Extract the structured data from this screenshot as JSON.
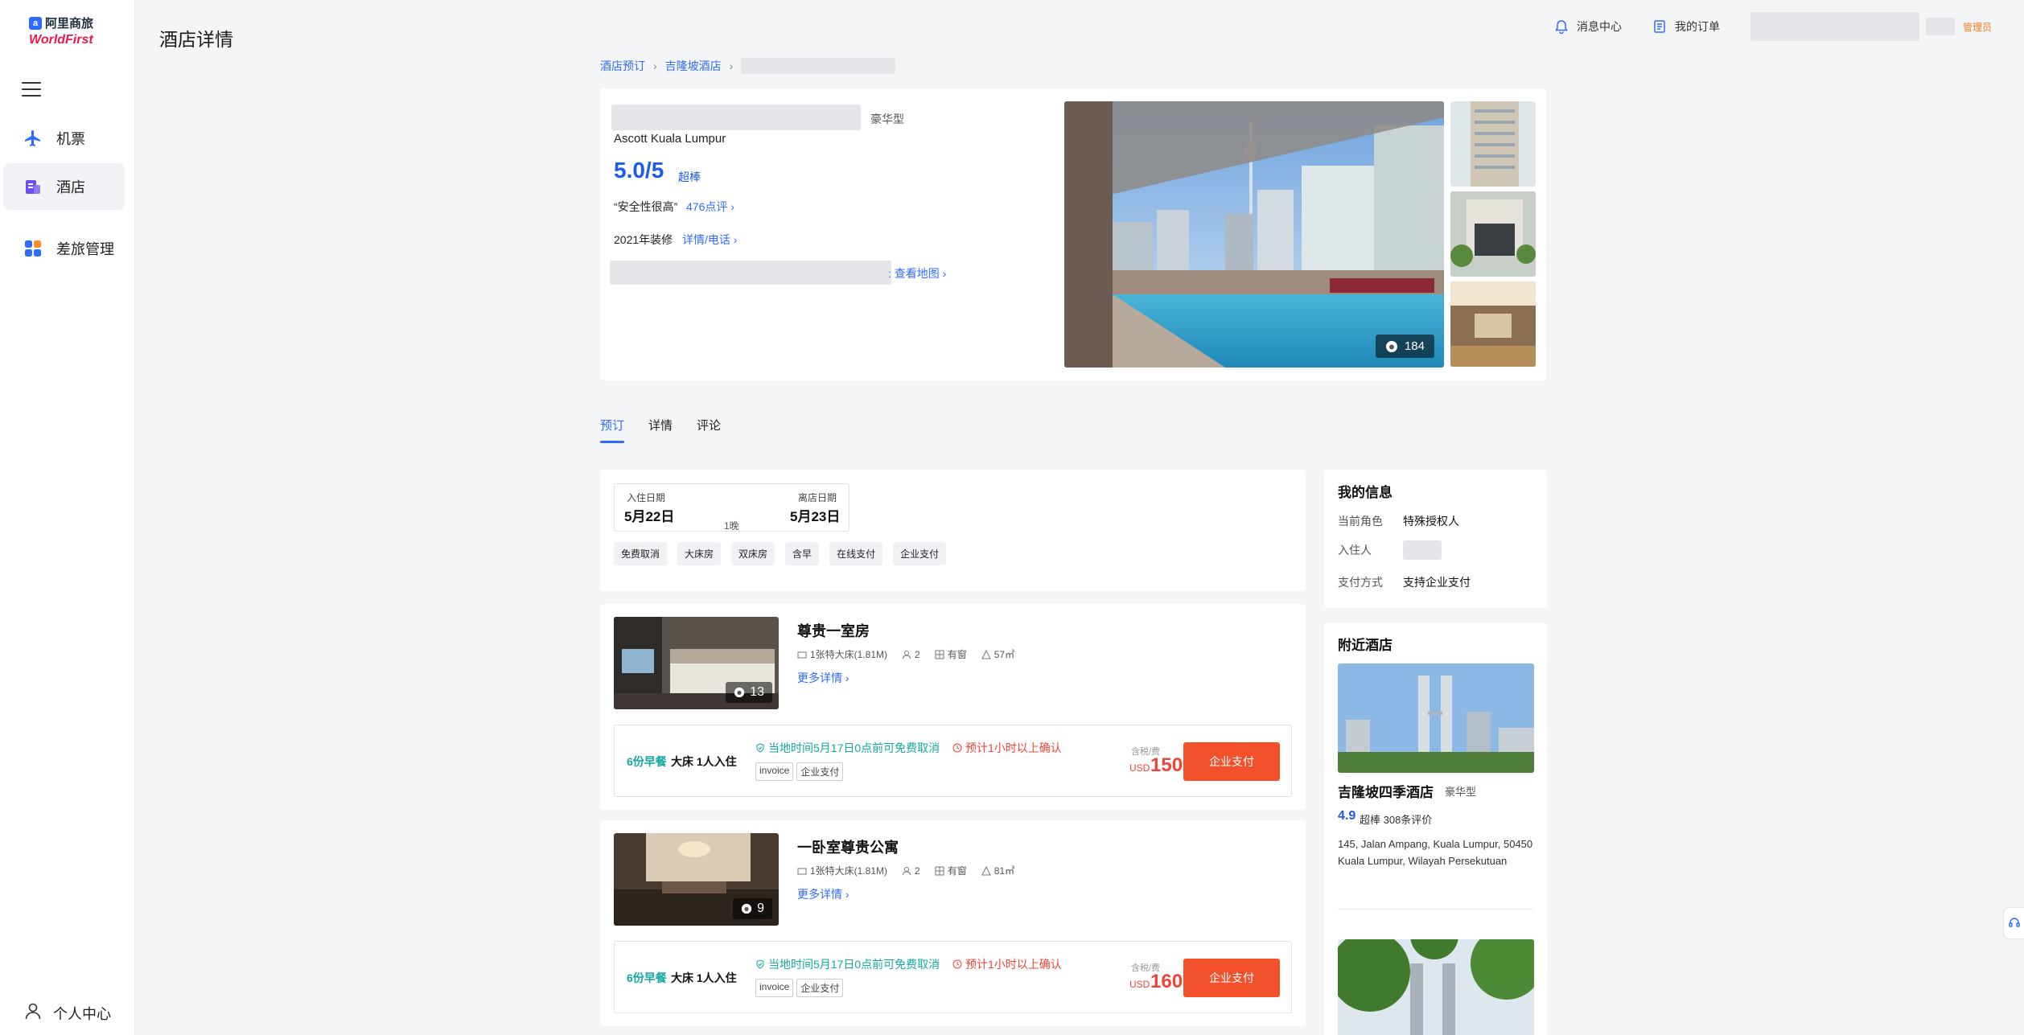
{
  "brand": {
    "line1": "阿里商旅",
    "line2": "WorldFirst"
  },
  "sidebar": {
    "items": [
      {
        "label": "机票",
        "icon": "plane-icon"
      },
      {
        "label": "酒店",
        "icon": "hotel-icon"
      },
      {
        "label": "差旅管理",
        "icon": "grid-icon"
      }
    ],
    "user_center": "个人中心"
  },
  "header": {
    "title": "酒店详情",
    "messages": "消息中心",
    "orders": "我的订单",
    "admin": "管理员"
  },
  "breadcrumb": {
    "home": "酒店预订",
    "city": "吉隆坡酒店"
  },
  "hotel": {
    "type": "豪华型",
    "name_en": "Ascott Kuala Lumpur",
    "score": "5.0/5",
    "score_word": "超棒",
    "quote": "“安全性很高”",
    "reviews": "476点评 ›",
    "renovation": "2021年装修",
    "detail_link": "详情/电话 ›",
    "map_link": ": 查看地图 ›",
    "photo_count": "184"
  },
  "tabs": [
    "预订",
    "详情",
    "评论"
  ],
  "dates": {
    "checkin_label": "入住日期",
    "checkin": "5月22日",
    "checkout_label": "离店日期",
    "checkout": "5月23日",
    "nights": "1晚"
  },
  "filters": [
    "免费取消",
    "大床房",
    "双床房",
    "含早",
    "在线支付",
    "企业支付"
  ],
  "rooms": [
    {
      "name": "尊贵一室房",
      "bed": "1张特大床(1.81M)",
      "guests": "2",
      "window": "有窗",
      "area": "57㎡",
      "more": "更多详情 ›",
      "photo_count": "13",
      "rate": {
        "meal": "6份早餐",
        "bed_type": "大床 1人入住",
        "cancel": "当地时间5月17日0点前可免费取消",
        "confirm": "预计1小时以上确认",
        "tags": [
          "invoice",
          "企业支付"
        ],
        "tax": "含税/费",
        "currency": "USD",
        "price": "150",
        "button": "企业支付"
      }
    },
    {
      "name": "一卧室尊贵公寓",
      "bed": "1张特大床(1.81M)",
      "guests": "2",
      "window": "有窗",
      "area": "81㎡",
      "more": "更多详情 ›",
      "photo_count": "9",
      "rate": {
        "meal": "6份早餐",
        "bed_type": "大床 1人入住",
        "cancel": "当地时间5月17日0点前可免费取消",
        "confirm": "预计1小时以上确认",
        "tags": [
          "invoice",
          "企业支付"
        ],
        "tax": "含税/费",
        "currency": "USD",
        "price": "160",
        "button": "企业支付"
      }
    }
  ],
  "my_info": {
    "title": "我的信息",
    "role_label": "当前角色",
    "role": "特殊授权人",
    "guest_label": "入住人",
    "payment_label": "支付方式",
    "payment": "支持企业支付"
  },
  "nearby": {
    "title": "附近酒店",
    "hotel_name": "吉隆坡四季酒店",
    "hotel_type": "豪华型",
    "score": "4.9",
    "score_text": "超棒 308条评价",
    "address": "145, Jalan Ampang, Kuala Lumpur, 50450 Kuala Lumpur, Wilayah Persekutuan"
  },
  "colors": {
    "accent": "#2f6bff",
    "pay": "#f2512c",
    "price": "#f04438",
    "teal": "#14a8a0"
  }
}
